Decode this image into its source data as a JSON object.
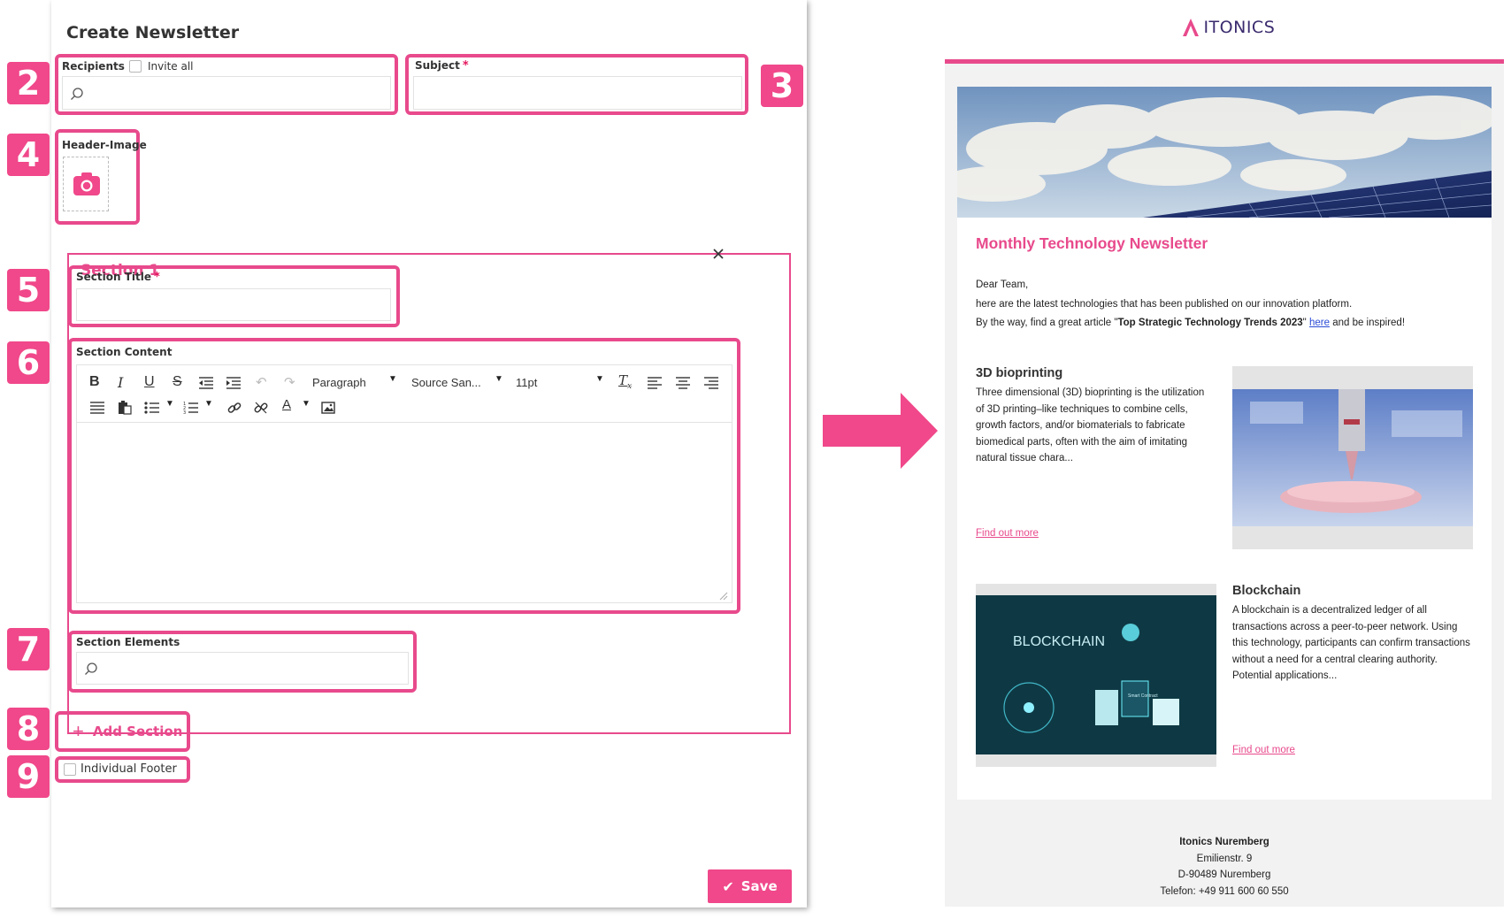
{
  "form": {
    "title": "Create Newsletter",
    "recipients_label": "Recipients",
    "invite_all_label": "Invite all",
    "subject_label": "Subject",
    "required_mark": "*",
    "header_image_label": "Header-Image",
    "section": {
      "title": "Section 1",
      "section_title_label": "Section Title",
      "section_content_label": "Section Content",
      "section_elements_label": "Section Elements",
      "editor": {
        "block_format": "Paragraph",
        "font_family": "Source San...",
        "font_size": "11pt"
      }
    },
    "add_section_label": "Add Section",
    "individual_footer_label": "Individual Footer",
    "save_label": "Save"
  },
  "badges": [
    "2",
    "3",
    "4",
    "5",
    "6",
    "7",
    "8",
    "9"
  ],
  "newsletter": {
    "logo_text": "ITONICS",
    "title": "Monthly Technology Newsletter",
    "greeting": "Dear Team,",
    "intro": "here are the latest technologies that has been published on our innovation platform.",
    "article_prefix": "By the way, find a great article \"",
    "article_title": "Top Strategic Technology Trends 2023",
    "article_link": "here",
    "article_suffix": "and be inspired!",
    "items": [
      {
        "heading": "3D bioprinting",
        "body": "Three dimensional (3D) bioprinting is the utilization of 3D printing–like techniques to combine cells, growth factors, and/or biomaterials to fabricate biomedical parts, often with the aim of imitating natural tissue chara...",
        "link": "Find out more"
      },
      {
        "heading": "Blockchain",
        "body": "A blockchain is a decentralized ledger of all transactions across a peer-to-peer network. Using this technology, participants can confirm transactions without a need for a central clearing authority. Potential applications...",
        "link": "Find out more",
        "image_label": "BLOCKCHAIN",
        "image_sub_label": "Smart Contract"
      }
    ],
    "footer": {
      "company": "Itonics Nuremberg",
      "street": "Emilienstr. 9",
      "city": "D-90489 Nuremberg",
      "phone": "Telefon: +49 911 600 60 550"
    }
  },
  "colors": {
    "accent": "#e84a8c",
    "badge": "#f0488a",
    "logo": "#3b2b6e",
    "link_blue": "#2b4bd6"
  }
}
